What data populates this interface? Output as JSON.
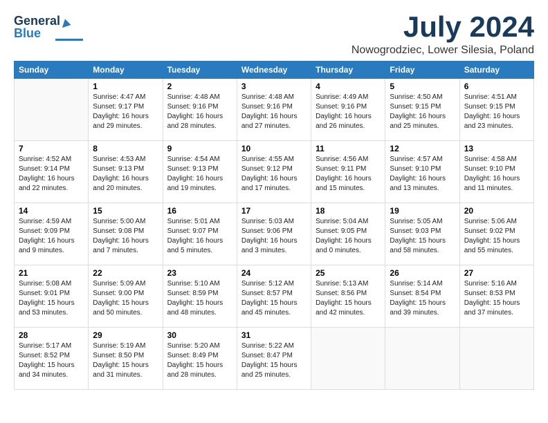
{
  "header": {
    "logo_line1": "General",
    "logo_line2": "Blue",
    "month": "July 2024",
    "location": "Nowogrodziec, Lower Silesia, Poland"
  },
  "weekdays": [
    "Sunday",
    "Monday",
    "Tuesday",
    "Wednesday",
    "Thursday",
    "Friday",
    "Saturday"
  ],
  "weeks": [
    [
      {
        "day": "",
        "info": ""
      },
      {
        "day": "1",
        "info": "Sunrise: 4:47 AM\nSunset: 9:17 PM\nDaylight: 16 hours\nand 29 minutes."
      },
      {
        "day": "2",
        "info": "Sunrise: 4:48 AM\nSunset: 9:16 PM\nDaylight: 16 hours\nand 28 minutes."
      },
      {
        "day": "3",
        "info": "Sunrise: 4:48 AM\nSunset: 9:16 PM\nDaylight: 16 hours\nand 27 minutes."
      },
      {
        "day": "4",
        "info": "Sunrise: 4:49 AM\nSunset: 9:16 PM\nDaylight: 16 hours\nand 26 minutes."
      },
      {
        "day": "5",
        "info": "Sunrise: 4:50 AM\nSunset: 9:15 PM\nDaylight: 16 hours\nand 25 minutes."
      },
      {
        "day": "6",
        "info": "Sunrise: 4:51 AM\nSunset: 9:15 PM\nDaylight: 16 hours\nand 23 minutes."
      }
    ],
    [
      {
        "day": "7",
        "info": "Sunrise: 4:52 AM\nSunset: 9:14 PM\nDaylight: 16 hours\nand 22 minutes."
      },
      {
        "day": "8",
        "info": "Sunrise: 4:53 AM\nSunset: 9:13 PM\nDaylight: 16 hours\nand 20 minutes."
      },
      {
        "day": "9",
        "info": "Sunrise: 4:54 AM\nSunset: 9:13 PM\nDaylight: 16 hours\nand 19 minutes."
      },
      {
        "day": "10",
        "info": "Sunrise: 4:55 AM\nSunset: 9:12 PM\nDaylight: 16 hours\nand 17 minutes."
      },
      {
        "day": "11",
        "info": "Sunrise: 4:56 AM\nSunset: 9:11 PM\nDaylight: 16 hours\nand 15 minutes."
      },
      {
        "day": "12",
        "info": "Sunrise: 4:57 AM\nSunset: 9:10 PM\nDaylight: 16 hours\nand 13 minutes."
      },
      {
        "day": "13",
        "info": "Sunrise: 4:58 AM\nSunset: 9:10 PM\nDaylight: 16 hours\nand 11 minutes."
      }
    ],
    [
      {
        "day": "14",
        "info": "Sunrise: 4:59 AM\nSunset: 9:09 PM\nDaylight: 16 hours\nand 9 minutes."
      },
      {
        "day": "15",
        "info": "Sunrise: 5:00 AM\nSunset: 9:08 PM\nDaylight: 16 hours\nand 7 minutes."
      },
      {
        "day": "16",
        "info": "Sunrise: 5:01 AM\nSunset: 9:07 PM\nDaylight: 16 hours\nand 5 minutes."
      },
      {
        "day": "17",
        "info": "Sunrise: 5:03 AM\nSunset: 9:06 PM\nDaylight: 16 hours\nand 3 minutes."
      },
      {
        "day": "18",
        "info": "Sunrise: 5:04 AM\nSunset: 9:05 PM\nDaylight: 16 hours\nand 0 minutes."
      },
      {
        "day": "19",
        "info": "Sunrise: 5:05 AM\nSunset: 9:03 PM\nDaylight: 15 hours\nand 58 minutes."
      },
      {
        "day": "20",
        "info": "Sunrise: 5:06 AM\nSunset: 9:02 PM\nDaylight: 15 hours\nand 55 minutes."
      }
    ],
    [
      {
        "day": "21",
        "info": "Sunrise: 5:08 AM\nSunset: 9:01 PM\nDaylight: 15 hours\nand 53 minutes."
      },
      {
        "day": "22",
        "info": "Sunrise: 5:09 AM\nSunset: 9:00 PM\nDaylight: 15 hours\nand 50 minutes."
      },
      {
        "day": "23",
        "info": "Sunrise: 5:10 AM\nSunset: 8:59 PM\nDaylight: 15 hours\nand 48 minutes."
      },
      {
        "day": "24",
        "info": "Sunrise: 5:12 AM\nSunset: 8:57 PM\nDaylight: 15 hours\nand 45 minutes."
      },
      {
        "day": "25",
        "info": "Sunrise: 5:13 AM\nSunset: 8:56 PM\nDaylight: 15 hours\nand 42 minutes."
      },
      {
        "day": "26",
        "info": "Sunrise: 5:14 AM\nSunset: 8:54 PM\nDaylight: 15 hours\nand 39 minutes."
      },
      {
        "day": "27",
        "info": "Sunrise: 5:16 AM\nSunset: 8:53 PM\nDaylight: 15 hours\nand 37 minutes."
      }
    ],
    [
      {
        "day": "28",
        "info": "Sunrise: 5:17 AM\nSunset: 8:52 PM\nDaylight: 15 hours\nand 34 minutes."
      },
      {
        "day": "29",
        "info": "Sunrise: 5:19 AM\nSunset: 8:50 PM\nDaylight: 15 hours\nand 31 minutes."
      },
      {
        "day": "30",
        "info": "Sunrise: 5:20 AM\nSunset: 8:49 PM\nDaylight: 15 hours\nand 28 minutes."
      },
      {
        "day": "31",
        "info": "Sunrise: 5:22 AM\nSunset: 8:47 PM\nDaylight: 15 hours\nand 25 minutes."
      },
      {
        "day": "",
        "info": ""
      },
      {
        "day": "",
        "info": ""
      },
      {
        "day": "",
        "info": ""
      }
    ]
  ]
}
